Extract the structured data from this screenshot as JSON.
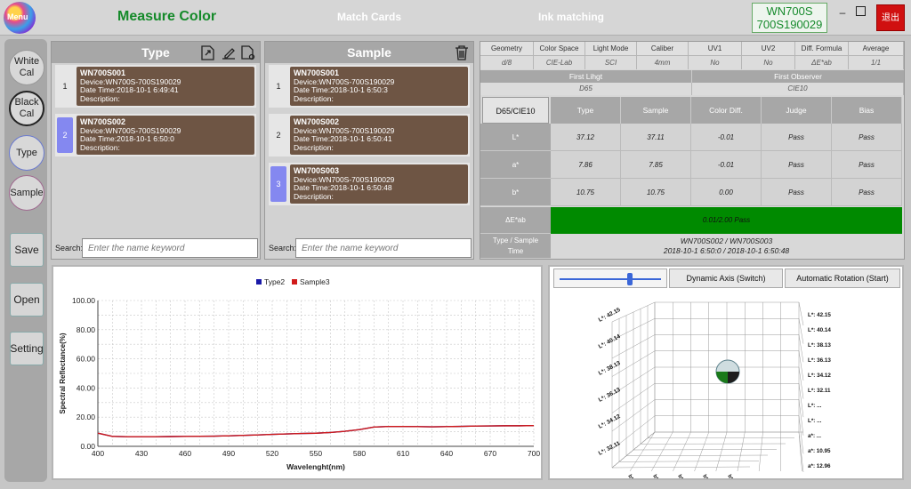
{
  "header": {
    "menu_label": "Menu",
    "title": "Measure Color",
    "nav": [
      "Match Cards",
      "Ink matching"
    ],
    "device_line1": "WN700S",
    "device_line2": "700S190029",
    "close_label": "退出"
  },
  "sidebar": {
    "white_cal": [
      "White",
      "Cal"
    ],
    "black_cal": [
      "Black",
      "Cal"
    ],
    "type": "Type",
    "sample": "Sample",
    "save": "Save",
    "open": "Open",
    "setting": "Setting"
  },
  "type_panel": {
    "title": "Type",
    "records": [
      {
        "index": "1",
        "name": "WN700S001",
        "device": "Device:WN700S-700S190029",
        "date": "Date Time:2018-10-1 6:49:41",
        "desc": "Description:"
      },
      {
        "index": "2",
        "name": "WN700S002",
        "device": "Device:WN700S-700S190029",
        "date": "Date Time:2018-10-1 6:50:0",
        "desc": "Description:"
      }
    ],
    "search_label": "Search:",
    "search_placeholder": "Enter the name keyword"
  },
  "sample_panel": {
    "title": "Sample",
    "records": [
      {
        "index": "1",
        "name": "WN700S001",
        "device": "Device:WN700S-700S190029",
        "date": "Date Time:2018-10-1 6:50:3",
        "desc": "Description:"
      },
      {
        "index": "2",
        "name": "WN700S002",
        "device": "Device:WN700S-700S190029",
        "date": "Date Time:2018-10-1 6:50:41",
        "desc": "Description:"
      },
      {
        "index": "3",
        "name": "WN700S003",
        "device": "Device:WN700S-700S190029",
        "date": "Date Time:2018-10-1 6:50:48",
        "desc": "Description:"
      }
    ],
    "search_label": "Search:",
    "search_placeholder": "Enter the name keyword"
  },
  "settings_table": {
    "headers": [
      "Geometry",
      "Color Space",
      "Light Mode",
      "Caliber",
      "UV1",
      "UV2",
      "Diff. Formula",
      "Average"
    ],
    "values": [
      "d/8",
      "CIE-Lab",
      "SCI",
      "4mm",
      "No",
      "No",
      "ΔE*ab",
      "1/1"
    ],
    "first_light_label": "First Lihgt",
    "first_light_value": "D65",
    "first_observer_label": "First Observer",
    "first_observer_value": "CIE10"
  },
  "measure_table": {
    "corner": "D65/CIE10",
    "columns": [
      "Type",
      "Sample",
      "Color Diff.",
      "Judge",
      "Bias"
    ],
    "rows": [
      {
        "label": "L*",
        "values": [
          "37.12",
          "37.11",
          "-0.01",
          "Pass",
          "Pass"
        ]
      },
      {
        "label": "a*",
        "values": [
          "7.86",
          "7.85",
          "-0.01",
          "Pass",
          "Pass"
        ]
      },
      {
        "label": "b*",
        "values": [
          "10.75",
          "10.75",
          "0.00",
          "Pass",
          "Pass"
        ]
      }
    ],
    "de_label": "ΔE*ab",
    "de_value": "0.01/2.00  Pass",
    "de_color": "#008a00",
    "pair_label": [
      "Type / Sample",
      "Time"
    ],
    "pair_names": "WN700S002 / WN700S003",
    "pair_times": "2018-10-1 6:50:0 / 2018-10-1 6:50:48"
  },
  "chart_data": {
    "type": "line",
    "xlabel": "Wavelenght(nm)",
    "ylabel": "Spectral Reflectance(%)",
    "xlim": [
      400,
      700
    ],
    "ylim": [
      0,
      100
    ],
    "xticks": [
      "400",
      "430",
      "460",
      "490",
      "520",
      "550",
      "580",
      "610",
      "640",
      "670",
      "700"
    ],
    "yticks": [
      "0.00",
      "20.00",
      "40.00",
      "60.00",
      "80.00",
      "100.00"
    ],
    "grid": true,
    "legend": "top-center",
    "x": [
      400,
      410,
      420,
      430,
      440,
      450,
      460,
      470,
      480,
      490,
      500,
      510,
      520,
      530,
      540,
      550,
      560,
      570,
      580,
      590,
      600,
      610,
      620,
      630,
      640,
      650,
      660,
      670,
      680,
      690,
      700
    ],
    "series": [
      {
        "name": "Type2",
        "color": "#1a1aa8",
        "values": [
          9.0,
          6.8,
          6.6,
          6.6,
          6.6,
          6.7,
          6.8,
          6.9,
          7.0,
          7.2,
          7.5,
          7.8,
          8.2,
          8.5,
          8.8,
          9.0,
          9.5,
          10.3,
          11.5,
          13.2,
          13.6,
          13.6,
          13.5,
          13.4,
          13.5,
          13.7,
          13.9,
          14.0,
          14.1,
          14.1,
          14.2
        ]
      },
      {
        "name": "Sample3",
        "color": "#d01a1a",
        "values": [
          9.0,
          6.8,
          6.6,
          6.6,
          6.6,
          6.7,
          6.8,
          6.9,
          7.0,
          7.2,
          7.5,
          7.8,
          8.2,
          8.5,
          8.8,
          9.0,
          9.5,
          10.3,
          11.5,
          13.2,
          13.6,
          13.6,
          13.5,
          13.4,
          13.5,
          13.7,
          13.9,
          14.0,
          14.1,
          14.1,
          14.2
        ]
      }
    ]
  },
  "view3d": {
    "slider_value": 0.7,
    "btn_dynamic": "Dynamic Axis (Switch)",
    "btn_rotation": "Automatic Rotation (Start)",
    "left_axis_labels": [
      "L*: 42.15",
      "L*: 40.14",
      "L*: 38.13",
      "L*: 36.13",
      "L*: 34.12",
      "L*: 32.11"
    ],
    "right_axis_labels": [
      "L*: 42.15",
      "L*: 40.14",
      "L*: 38.13",
      "L*: 36.13",
      "L*: 34.12",
      "L*: 32.11",
      "L*: ...",
      "L*: ...",
      "a*: ...",
      "a*: 10.95",
      "a*: 12.96"
    ],
    "bottom_labels": [
      "b*: 5.75",
      "b*: 7.76",
      "b*: 9.77",
      "b*: 11.78",
      "b*: 13.79"
    ]
  }
}
